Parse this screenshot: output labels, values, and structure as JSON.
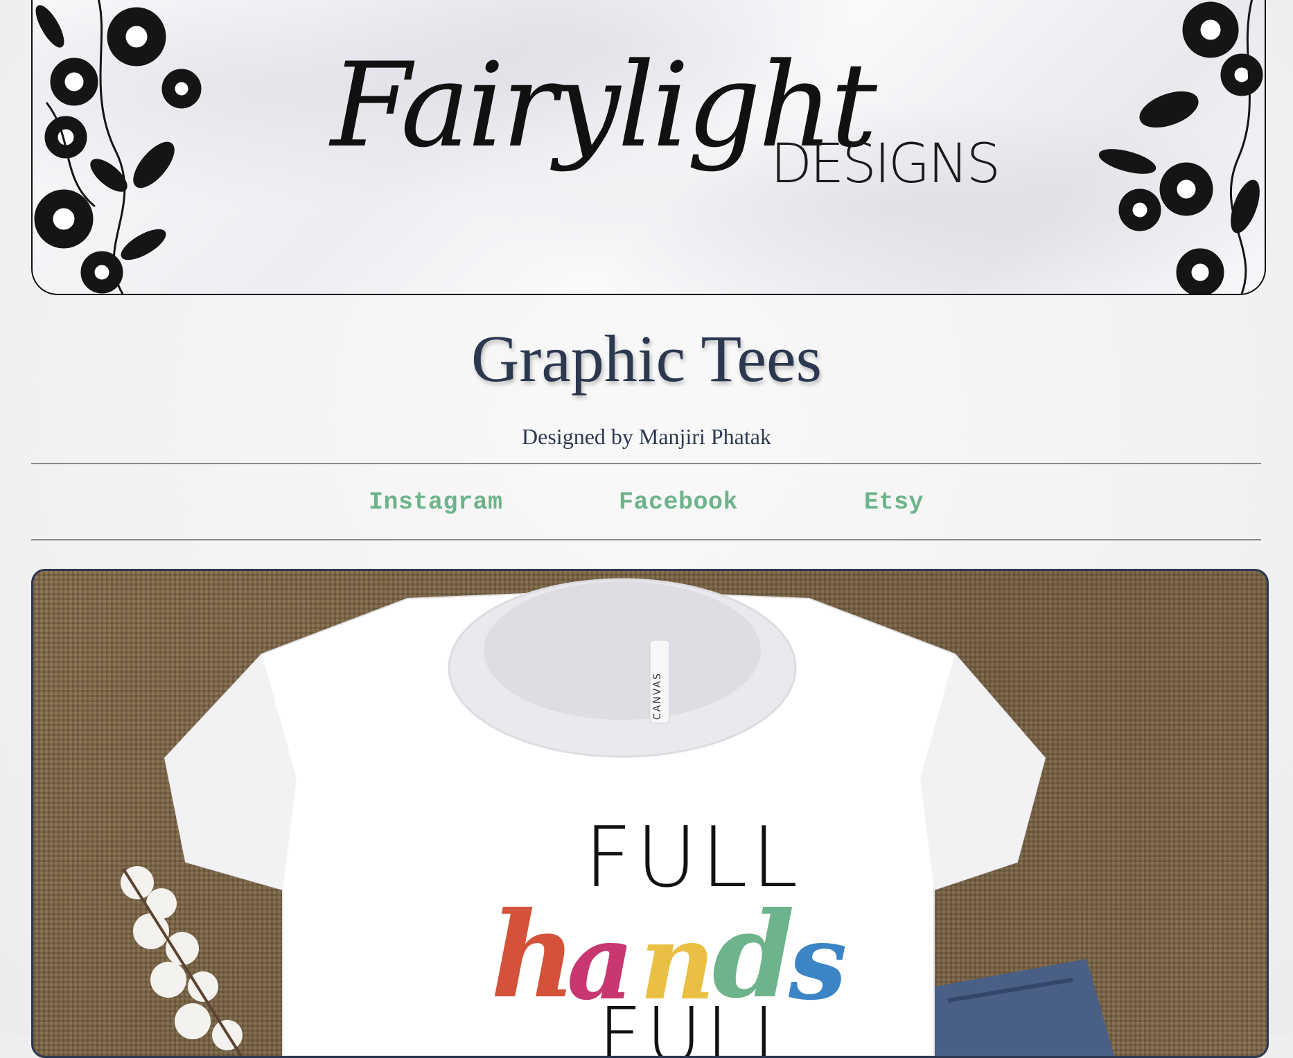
{
  "banner": {
    "logo_script": "Fairylight",
    "logo_caps": "DESIGNS"
  },
  "page": {
    "title": "Graphic Tees",
    "subtitle": "Designed by Manjiri Phatak"
  },
  "nav": {
    "links": [
      {
        "label": "Instagram"
      },
      {
        "label": "Facebook"
      },
      {
        "label": "Etsy"
      }
    ]
  },
  "product": {
    "shirt_text": {
      "line1": "FULL",
      "line2_letters": [
        "h",
        "a",
        "n",
        "d",
        "s"
      ],
      "line3": "FULL"
    },
    "tag": "CANVAS",
    "colors": {
      "h": "#d4513a",
      "a": "#c8376f",
      "n": "#e9c043",
      "d": "#6db38b",
      "s": "#3b85c6"
    }
  },
  "theme": {
    "title_color": "#2c3850",
    "link_color": "#6db38b",
    "rule_color": "#8a8a8a"
  }
}
